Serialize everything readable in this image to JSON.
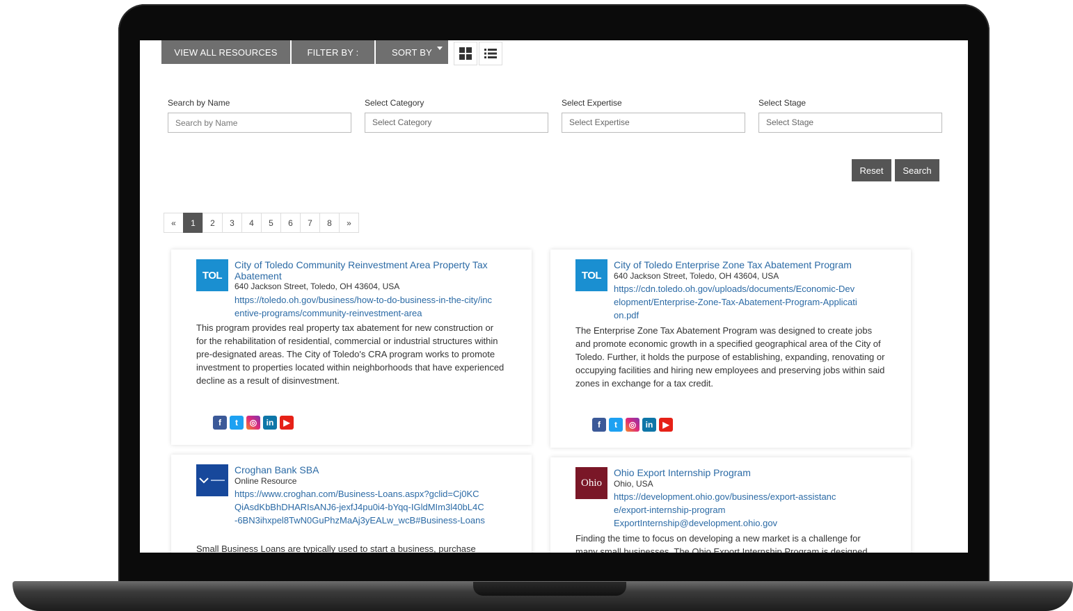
{
  "toolbar": {
    "view_all": "VIEW ALL RESOURCES",
    "filter_by": "FILTER BY :",
    "sort_by": "SORT BY",
    "grid_icon": "grid-view-icon",
    "list_icon": "list-view-icon"
  },
  "filters": {
    "name_label": "Search by Name",
    "name_placeholder": "Search by Name",
    "category_label": "Select Category",
    "category_value": "Select Category",
    "expertise_label": "Select Expertise",
    "expertise_value": "Select Expertise",
    "stage_label": "Select Stage",
    "stage_value": "Select Stage",
    "reset": "Reset",
    "search": "Search"
  },
  "pagination": {
    "prev": "«",
    "pages": [
      "1",
      "2",
      "3",
      "4",
      "5",
      "6",
      "7",
      "8"
    ],
    "next": "»",
    "active": "1"
  },
  "cards": [
    {
      "logo_text": "TOL",
      "title": "City of Toledo Community Reinvestment Area Property Tax Abatement",
      "address": "640 Jackson Street, Toledo, OH 43604, USA",
      "link": "https://toledo.oh.gov/business/how-to-do-business-in-the-city/incentive-programs/community-reinvestment-area",
      "description": "This program provides real property tax abatement for new construction or for the rehabilitation of residential, commercial or industrial structures within pre-designated areas. The City of Toledo's CRA program works to promote investment to properties located within neighborhoods that have experienced decline as a result of disinvestment."
    },
    {
      "logo_text": "TOL",
      "title": "City of Toledo Enterprise Zone Tax Abatement Program",
      "address": "640 Jackson Street, Toledo, OH 43604, USA",
      "link": "https://cdn.toledo.oh.gov/uploads/documents/Economic-Development/Enterprise-Zone-Tax-Abatement-Program-Application.pdf",
      "description": "The Enterprise Zone Tax Abatement Program was designed to create jobs and promote economic growth in a specified geographical area of the City of Toledo. Further, it holds the purpose of establishing, expanding, renovating or occupying facilities and hiring new employees and preserving jobs within said zones in exchange for a tax credit."
    },
    {
      "title": "Croghan Bank SBA",
      "address": "Online Resource",
      "link": "https://www.croghan.com/Business-Loans.aspx?gclid=Cj0KCQiAsdKbBhDHARIsANJ6-jexfJ4pu0i4-bYqq-IGldMIm3l40bL4C-6BN3ihxpel8TwN0GuPhzMaAj3yEALw_wcB#Business-Loans",
      "description": "Small Business Loans are typically used to start a business, purchase"
    },
    {
      "logo_text": "Ohio",
      "title": "Ohio Export Internship Program",
      "address": "Ohio, USA",
      "link": "https://development.ohio.gov/business/export-assistance/export-internship-program",
      "email": "ExportInternship@development.ohio.gov",
      "description": "Finding the time to focus on developing a new market is a challenge for many small businesses. The Ohio Export Internship Program is designed"
    }
  ],
  "social_icons": [
    "facebook-icon",
    "twitter-icon",
    "instagram-icon",
    "linkedin-icon",
    "youtube-icon"
  ]
}
